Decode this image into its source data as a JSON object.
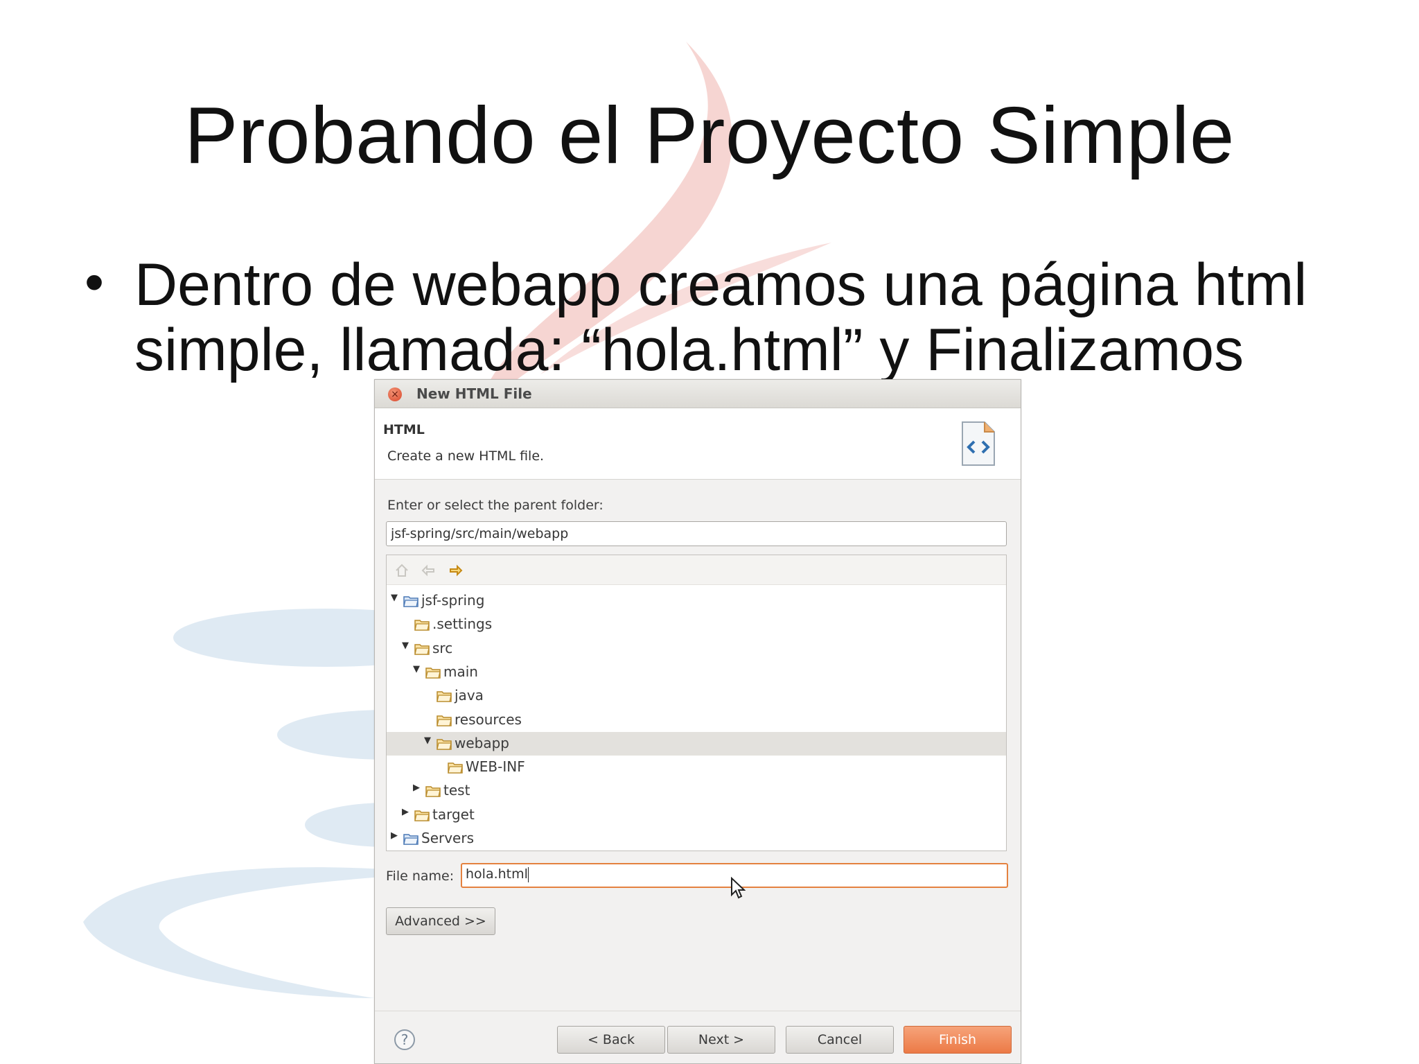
{
  "slide": {
    "title": "Probando el Proyecto Simple",
    "bullet_line1": "Dentro de webapp creamos una página html",
    "bullet_line2": "simple, llamada: “hola.html” y Finalizamos"
  },
  "dialog": {
    "window_title": "New HTML File",
    "header_title": "HTML",
    "header_desc": "Create a new HTML file.",
    "parent_label": "Enter or select the parent folder:",
    "parent_value": "jsf-spring/src/main/webapp",
    "tree": [
      {
        "label": "jsf-spring",
        "state": "expanded",
        "icon": "project-folder-icon"
      },
      {
        "label": ".settings",
        "state": "none",
        "icon": "folder-icon"
      },
      {
        "label": "src",
        "state": "expanded",
        "icon": "folder-icon"
      },
      {
        "label": "main",
        "state": "expanded",
        "icon": "folder-icon"
      },
      {
        "label": "java",
        "state": "none",
        "icon": "folder-icon"
      },
      {
        "label": "resources",
        "state": "none",
        "icon": "folder-icon"
      },
      {
        "label": "webapp",
        "state": "expanded",
        "icon": "folder-icon",
        "selected": true
      },
      {
        "label": "WEB-INF",
        "state": "none",
        "icon": "folder-icon"
      },
      {
        "label": "test",
        "state": "collapsed",
        "icon": "folder-icon"
      },
      {
        "label": "target",
        "state": "collapsed",
        "icon": "folder-icon"
      },
      {
        "label": "Servers",
        "state": "collapsed",
        "icon": "project-folder-icon"
      }
    ],
    "file_label": "File name:",
    "file_value": "hola.html",
    "advanced_button": "Advanced >>",
    "back_button": "< Back",
    "next_button": "Next >",
    "cancel_button": "Cancel",
    "finish_button": "Finish"
  },
  "colors": {
    "accent": "#ec7a46",
    "selection": "#e3e1dd",
    "close": "#d8452a"
  }
}
